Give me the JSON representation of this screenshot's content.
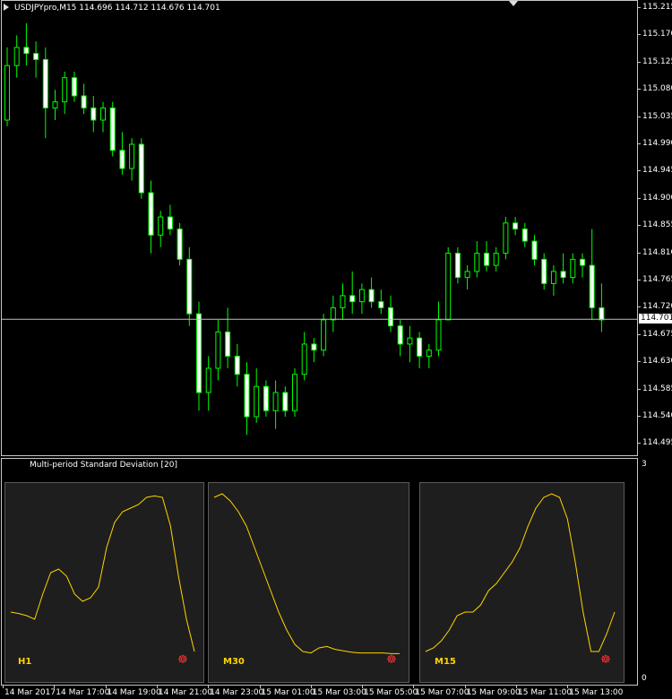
{
  "main_chart": {
    "title": "USDJPYpro,M15  114.696 114.712 114.676 114.701",
    "current_price": "114.701",
    "price_line_value": 114.701,
    "colors": {
      "bull_body": "#000000",
      "bull_outline": "#00ff00",
      "bear_body": "#ffffff",
      "wick": "#00ff00",
      "price_line": "#c0c0c0"
    }
  },
  "indicator": {
    "title": "Multi-period Standard Deviation [20]",
    "axis_top": "3",
    "axis_bottom": "0",
    "line_color": "#ffd400",
    "panels": [
      {
        "label": "H1",
        "icon": "bug-icon"
      },
      {
        "label": "M30",
        "icon": "bug-icon"
      },
      {
        "label": "M15",
        "icon": "bug-icon"
      }
    ]
  },
  "price_axis": [
    "115.215",
    "115.170",
    "115.125",
    "115.080",
    "115.035",
    "114.990",
    "114.945",
    "114.900",
    "114.855",
    "114.810",
    "114.765",
    "114.720",
    "114.675",
    "114.630",
    "114.585",
    "114.540",
    "114.495"
  ],
  "time_axis": [
    "14 Mar 2017",
    "14 Mar 17:00",
    "14 Mar 19:00",
    "14 Mar 21:00",
    "14 Mar 23:00",
    "15 Mar 01:00",
    "15 Mar 03:00",
    "15 Mar 05:00",
    "15 Mar 07:00",
    "15 Mar 09:00",
    "15 Mar 11:00",
    "15 Mar 13:00"
  ],
  "chart_data": [
    {
      "type": "candlestick",
      "title": "USDJPYpro,M15",
      "ylim": [
        114.48,
        115.23
      ],
      "candles": [
        {
          "o": 115.03,
          "h": 115.15,
          "l": 115.02,
          "c": 115.12
        },
        {
          "o": 115.12,
          "h": 115.17,
          "l": 115.1,
          "c": 115.15
        },
        {
          "o": 115.15,
          "h": 115.19,
          "l": 115.12,
          "c": 115.14
        },
        {
          "o": 115.14,
          "h": 115.16,
          "l": 115.1,
          "c": 115.13
        },
        {
          "o": 115.13,
          "h": 115.15,
          "l": 115.0,
          "c": 115.05
        },
        {
          "o": 115.05,
          "h": 115.08,
          "l": 115.03,
          "c": 115.06
        },
        {
          "o": 115.06,
          "h": 115.11,
          "l": 115.04,
          "c": 115.1
        },
        {
          "o": 115.1,
          "h": 115.11,
          "l": 115.06,
          "c": 115.07
        },
        {
          "o": 115.07,
          "h": 115.09,
          "l": 115.04,
          "c": 115.05
        },
        {
          "o": 115.05,
          "h": 115.07,
          "l": 115.01,
          "c": 115.03
        },
        {
          "o": 115.03,
          "h": 115.06,
          "l": 115.01,
          "c": 115.05
        },
        {
          "o": 115.05,
          "h": 115.06,
          "l": 114.97,
          "c": 114.98
        },
        {
          "o": 114.98,
          "h": 115.01,
          "l": 114.94,
          "c": 114.95
        },
        {
          "o": 114.95,
          "h": 115.0,
          "l": 114.93,
          "c": 114.99
        },
        {
          "o": 114.99,
          "h": 115.0,
          "l": 114.9,
          "c": 114.91
        },
        {
          "o": 114.91,
          "h": 114.93,
          "l": 114.81,
          "c": 114.84
        },
        {
          "o": 114.84,
          "h": 114.88,
          "l": 114.82,
          "c": 114.87
        },
        {
          "o": 114.87,
          "h": 114.89,
          "l": 114.84,
          "c": 114.85
        },
        {
          "o": 114.85,
          "h": 114.86,
          "l": 114.79,
          "c": 114.8
        },
        {
          "o": 114.8,
          "h": 114.82,
          "l": 114.69,
          "c": 114.71
        },
        {
          "o": 114.71,
          "h": 114.73,
          "l": 114.55,
          "c": 114.58
        },
        {
          "o": 114.58,
          "h": 114.64,
          "l": 114.55,
          "c": 114.62
        },
        {
          "o": 114.62,
          "h": 114.7,
          "l": 114.6,
          "c": 114.68
        },
        {
          "o": 114.68,
          "h": 114.72,
          "l": 114.62,
          "c": 114.64
        },
        {
          "o": 114.64,
          "h": 114.66,
          "l": 114.59,
          "c": 114.61
        },
        {
          "o": 114.61,
          "h": 114.63,
          "l": 114.51,
          "c": 114.54
        },
        {
          "o": 114.54,
          "h": 114.62,
          "l": 114.53,
          "c": 114.59
        },
        {
          "o": 114.59,
          "h": 114.6,
          "l": 114.54,
          "c": 114.55
        },
        {
          "o": 114.55,
          "h": 114.6,
          "l": 114.52,
          "c": 114.58
        },
        {
          "o": 114.58,
          "h": 114.59,
          "l": 114.54,
          "c": 114.55
        },
        {
          "o": 114.55,
          "h": 114.62,
          "l": 114.54,
          "c": 114.61
        },
        {
          "o": 114.61,
          "h": 114.68,
          "l": 114.6,
          "c": 114.66
        },
        {
          "o": 114.66,
          "h": 114.67,
          "l": 114.63,
          "c": 114.65
        },
        {
          "o": 114.65,
          "h": 114.71,
          "l": 114.64,
          "c": 114.7
        },
        {
          "o": 114.7,
          "h": 114.74,
          "l": 114.68,
          "c": 114.72
        },
        {
          "o": 114.72,
          "h": 114.76,
          "l": 114.7,
          "c": 114.74
        },
        {
          "o": 114.74,
          "h": 114.78,
          "l": 114.71,
          "c": 114.73
        },
        {
          "o": 114.73,
          "h": 114.76,
          "l": 114.71,
          "c": 114.75
        },
        {
          "o": 114.75,
          "h": 114.77,
          "l": 114.72,
          "c": 114.73
        },
        {
          "o": 114.73,
          "h": 114.75,
          "l": 114.71,
          "c": 114.72
        },
        {
          "o": 114.72,
          "h": 114.74,
          "l": 114.68,
          "c": 114.69
        },
        {
          "o": 114.69,
          "h": 114.7,
          "l": 114.64,
          "c": 114.66
        },
        {
          "o": 114.66,
          "h": 114.69,
          "l": 114.63,
          "c": 114.67
        },
        {
          "o": 114.67,
          "h": 114.68,
          "l": 114.62,
          "c": 114.64
        },
        {
          "o": 114.64,
          "h": 114.66,
          "l": 114.62,
          "c": 114.65
        },
        {
          "o": 114.65,
          "h": 114.73,
          "l": 114.64,
          "c": 114.7
        },
        {
          "o": 114.7,
          "h": 114.82,
          "l": 114.7,
          "c": 114.81
        },
        {
          "o": 114.81,
          "h": 114.82,
          "l": 114.76,
          "c": 114.77
        },
        {
          "o": 114.77,
          "h": 114.79,
          "l": 114.75,
          "c": 114.78
        },
        {
          "o": 114.78,
          "h": 114.83,
          "l": 114.77,
          "c": 114.81
        },
        {
          "o": 114.81,
          "h": 114.83,
          "l": 114.78,
          "c": 114.79
        },
        {
          "o": 114.79,
          "h": 114.82,
          "l": 114.78,
          "c": 114.81
        },
        {
          "o": 114.81,
          "h": 114.87,
          "l": 114.8,
          "c": 114.86
        },
        {
          "o": 114.86,
          "h": 114.87,
          "l": 114.84,
          "c": 114.85
        },
        {
          "o": 114.85,
          "h": 114.86,
          "l": 114.82,
          "c": 114.83
        },
        {
          "o": 114.83,
          "h": 114.84,
          "l": 114.79,
          "c": 114.8
        },
        {
          "o": 114.8,
          "h": 114.81,
          "l": 114.75,
          "c": 114.76
        },
        {
          "o": 114.76,
          "h": 114.79,
          "l": 114.74,
          "c": 114.78
        },
        {
          "o": 114.78,
          "h": 114.81,
          "l": 114.76,
          "c": 114.77
        },
        {
          "o": 114.77,
          "h": 114.81,
          "l": 114.76,
          "c": 114.8
        },
        {
          "o": 114.8,
          "h": 114.81,
          "l": 114.77,
          "c": 114.79
        },
        {
          "o": 114.79,
          "h": 114.85,
          "l": 114.7,
          "c": 114.72
        },
        {
          "o": 114.72,
          "h": 114.76,
          "l": 114.68,
          "c": 114.7
        }
      ]
    },
    {
      "type": "line",
      "title": "Multi-period Standard Deviation [20]",
      "ylim": [
        0,
        3
      ],
      "series": [
        {
          "name": "H1",
          "values": [
            0.6,
            0.58,
            0.55,
            0.5,
            0.85,
            1.15,
            1.2,
            1.1,
            0.85,
            0.75,
            0.8,
            0.95,
            1.5,
            1.85,
            2.0,
            2.05,
            2.1,
            2.2,
            2.22,
            2.2,
            1.8,
            1.1,
            0.5,
            0.05
          ]
        },
        {
          "name": "M30",
          "values": [
            2.2,
            2.25,
            2.15,
            2.0,
            1.8,
            1.5,
            1.2,
            0.9,
            0.6,
            0.35,
            0.15,
            0.05,
            0.03,
            0.1,
            0.12,
            0.08,
            0.06,
            0.04,
            0.03,
            0.03,
            0.03,
            0.03,
            0.02,
            0.02
          ]
        },
        {
          "name": "M15",
          "values": [
            0.05,
            0.1,
            0.2,
            0.35,
            0.55,
            0.6,
            0.6,
            0.7,
            0.9,
            1.0,
            1.15,
            1.3,
            1.5,
            1.8,
            2.05,
            2.2,
            2.25,
            2.2,
            1.9,
            1.3,
            0.6,
            0.05,
            0.05,
            0.3,
            0.6
          ]
        }
      ]
    }
  ]
}
